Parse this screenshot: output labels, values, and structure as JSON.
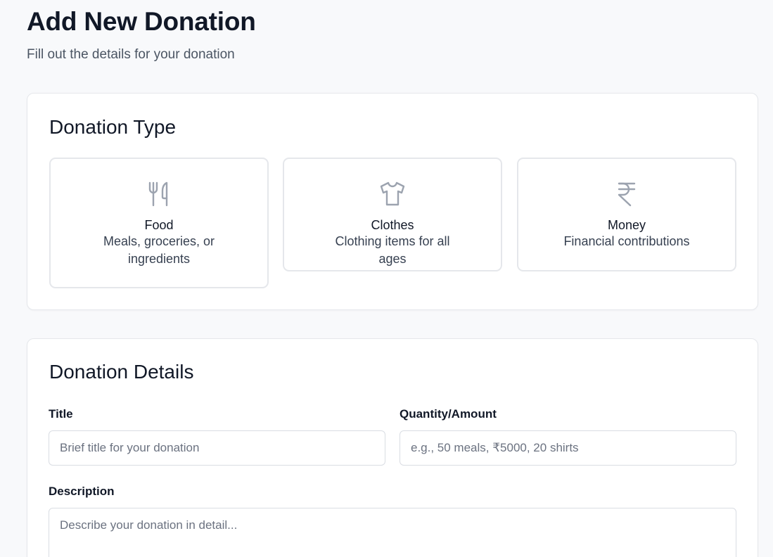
{
  "page": {
    "title": "Add New Donation",
    "subtitle": "Fill out the details for your donation"
  },
  "donation_type": {
    "heading": "Donation Type",
    "options": [
      {
        "name": "Food",
        "description": "Meals, groceries, or ingredients",
        "icon": "utensils-icon"
      },
      {
        "name": "Clothes",
        "description": "Clothing items for all ages",
        "icon": "shirt-icon"
      },
      {
        "name": "Money",
        "description": "Financial contributions",
        "icon": "rupee-icon"
      }
    ]
  },
  "donation_details": {
    "heading": "Donation Details",
    "title_field": {
      "label": "Title",
      "placeholder": "Brief title for your donation",
      "value": ""
    },
    "quantity_field": {
      "label": "Quantity/Amount",
      "placeholder": "e.g., 50 meals, ₹5000, 20 shirts",
      "value": ""
    },
    "description_field": {
      "label": "Description",
      "placeholder": "Describe your donation in detail...",
      "value": ""
    }
  },
  "colors": {
    "background": "#f8f9fb",
    "card": "#ffffff",
    "border": "#e5e7eb",
    "icon": "#9ca3af",
    "text": "#111827",
    "muted": "#4b5563"
  }
}
